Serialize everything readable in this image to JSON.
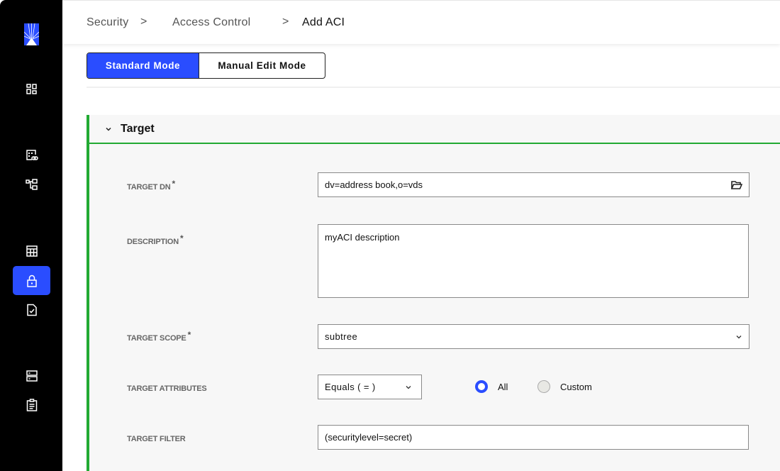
{
  "sidebar": {
    "logo": "brand-logo",
    "items": [
      {
        "icon": "dashboard-icon",
        "active": false
      },
      {
        "icon": "directory-link-icon",
        "active": false
      },
      {
        "icon": "hierarchy-icon",
        "active": false
      },
      {
        "icon": "table-icon",
        "active": false
      },
      {
        "icon": "lock-icon",
        "active": true
      },
      {
        "icon": "document-check-icon",
        "active": false
      },
      {
        "icon": "server-icon",
        "active": false
      },
      {
        "icon": "clipboard-icon",
        "active": false
      }
    ]
  },
  "breadcrumb": {
    "items": [
      "Security",
      "Access Control",
      "Add ACI"
    ],
    "separator": ">"
  },
  "mode_toggle": {
    "standard_label": "Standard Mode",
    "manual_label": "Manual Edit Mode",
    "selected": "Standard Mode"
  },
  "colors": {
    "accent": "#2a4dff",
    "panel_border": "#22aa33",
    "sidebar_bg": "#000000"
  },
  "panel": {
    "title": "Target",
    "expanded": true,
    "fields": {
      "target_dn": {
        "label": "TARGET DN",
        "required": "*",
        "value": "dv=address book,o=vds",
        "icon": "folder-open-icon"
      },
      "description": {
        "label": "DESCRIPTION",
        "required": "*",
        "value": "myACI description"
      },
      "target_scope": {
        "label": "TARGET SCOPE",
        "required": "*",
        "value": "subtree"
      },
      "target_attributes": {
        "label": "TARGET ATTRIBUTES",
        "operator": "Equals ( = )",
        "options": [
          {
            "label": "All",
            "selected": true
          },
          {
            "label": "Custom",
            "selected": false
          }
        ]
      },
      "target_filter": {
        "label": "TARGET FILTER",
        "value": "(securitylevel=secret)"
      }
    }
  }
}
